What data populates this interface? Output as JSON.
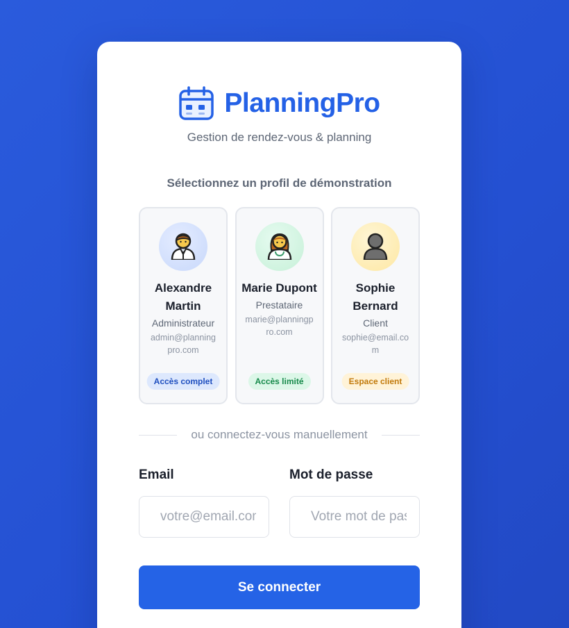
{
  "brand": {
    "title": "PlanningPro",
    "icon": "calendar-icon",
    "subtitle": "Gestion de rendez-vous & planning"
  },
  "demo": {
    "heading": "Sélectionnez un profil de démonstration",
    "profiles": [
      {
        "name": "Alexandre Martin",
        "role": "Administrateur",
        "email": "admin@planningpro.com",
        "badge": "Accès complet",
        "avatar_icon": "man-office-worker-icon",
        "accent": "#1f4fbf"
      },
      {
        "name": "Marie Dupont",
        "role": "Prestataire",
        "email": "marie@planningpro.com",
        "badge": "Accès limité",
        "avatar_icon": "woman-health-worker-icon",
        "accent": "#178a4b"
      },
      {
        "name": "Sophie Bernard",
        "role": "Client",
        "email": "sophie@email.com",
        "badge": "Espace client",
        "avatar_icon": "person-silhouette-icon",
        "accent": "#c27a0b"
      }
    ]
  },
  "divider": {
    "text": "ou connectez-vous manuellement"
  },
  "form": {
    "email_label": "Email",
    "email_placeholder": "votre@email.com",
    "password_label": "Mot de passe",
    "password_placeholder": "Votre mot de passe",
    "submit_label": "Se connecter"
  },
  "colors": {
    "background": "#2450d2",
    "primary": "#2563e6",
    "brand_text": "#2461e6"
  }
}
